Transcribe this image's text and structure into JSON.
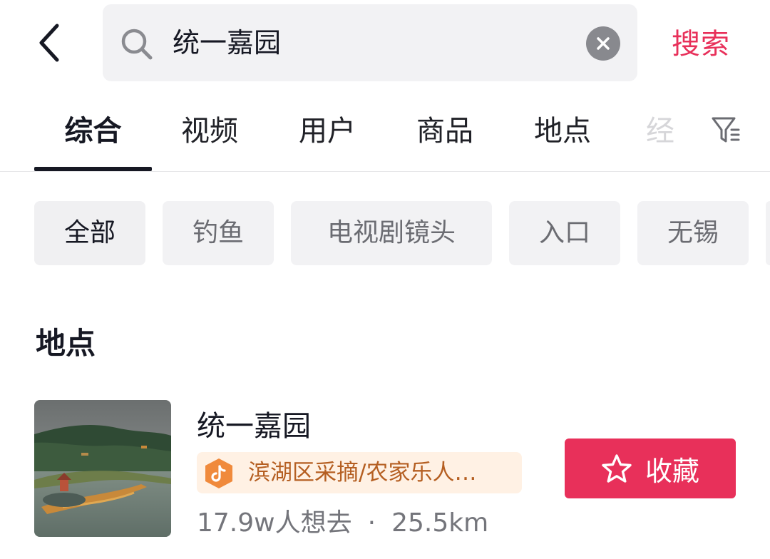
{
  "search": {
    "query": "统一嘉园",
    "submit_label": "搜索"
  },
  "tabs": [
    {
      "label": "综合",
      "active": true
    },
    {
      "label": "视频",
      "active": false
    },
    {
      "label": "用户",
      "active": false
    },
    {
      "label": "商品",
      "active": false
    },
    {
      "label": "地点",
      "active": false
    },
    {
      "label": "经",
      "active": false
    }
  ],
  "chips": [
    {
      "label": "全部",
      "active": true
    },
    {
      "label": "钓鱼",
      "active": false
    },
    {
      "label": "电视剧镜头",
      "active": false
    },
    {
      "label": "入口",
      "active": false
    },
    {
      "label": "无锡",
      "active": false
    }
  ],
  "section": {
    "title": "地点"
  },
  "place": {
    "name": "统一嘉园",
    "tag": "滨湖区采摘/农家乐人…",
    "wants": "17.9w人想去",
    "separator": "·",
    "distance": "25.5km",
    "collect_label": "收藏"
  },
  "colors": {
    "accent": "#e8305a",
    "tag_bg": "#fff1e4",
    "tag_text": "#b55f22",
    "chip_bg": "#f2f2f4"
  },
  "icons": {
    "back": "chevron-left-icon",
    "search": "search-icon",
    "clear": "close-circle-icon",
    "filter": "filter-icon",
    "tag": "douyin-logo-icon",
    "collect": "star-outline-icon"
  }
}
